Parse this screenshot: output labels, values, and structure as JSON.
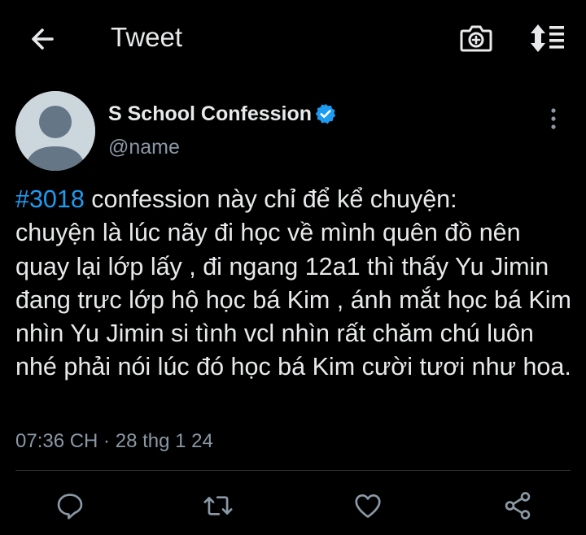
{
  "header": {
    "title": "Tweet"
  },
  "icons": {
    "back": "arrow-left-icon",
    "camera": "camera-icon",
    "sort": "sort-icon",
    "more": "more-vertical-icon",
    "verified": "verified-badge-icon",
    "reply": "reply-icon",
    "retweet": "retweet-icon",
    "like": "heart-icon",
    "share": "share-icon"
  },
  "colors": {
    "accent": "#1d9bf0",
    "text": "#e7e9ea",
    "secondary": "#8b98a5",
    "background": "#000000"
  },
  "tweet": {
    "author_name": "S School Confession",
    "author_handle": "@name",
    "hashtag": "#3018",
    "text_part1": " confession này chỉ để kể chuyện:",
    "text_rest": "chuyện là lúc nãy đi học về mình quên đồ nên quay lại lớp lấy , đi ngang 12a1 thì thấy Yu Jimin đang trực lớp hộ học bá Kim , ánh mắt học bá Kim nhìn Yu Jimin si tình vcl nhìn rất chăm chú luôn nhé phải nói lúc đó học bá Kim cười tươi như hoa.",
    "timestamp": "07:36 CH · 28 thg 1 24"
  }
}
